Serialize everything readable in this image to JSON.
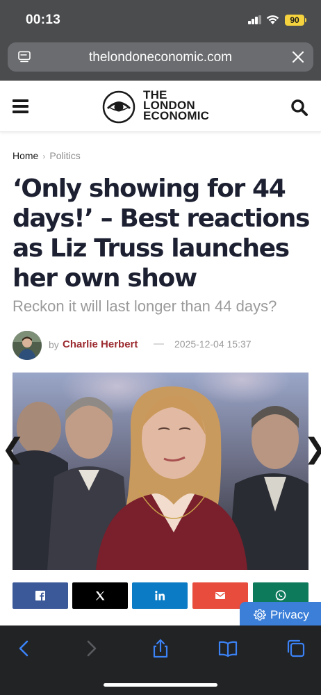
{
  "status_bar": {
    "time": "00:13",
    "battery_level": "90"
  },
  "browser": {
    "url": "thelondoneconomic.com"
  },
  "site": {
    "logo_lines": [
      "THE",
      "LONDON",
      "ECONOMIC"
    ]
  },
  "breadcrumb": {
    "home": "Home",
    "separator": "›",
    "category": "Politics"
  },
  "article": {
    "headline": "‘Only showing for 44 days!’ – Best reactions as Liz Truss launches her own show",
    "subheadline": "Reckon it will last longer than 44 days?",
    "byline_prefix": "by",
    "author": "Charlie Herbert",
    "dash": "—",
    "date": "2025-12-04 15:37"
  },
  "gallery": {
    "prev_glyph": "❮",
    "next_glyph": "❯"
  },
  "share": [
    {
      "network": "facebook",
      "icon": "facebook-icon",
      "color": "#3b5998"
    },
    {
      "network": "x",
      "icon": "x-icon",
      "color": "#000000"
    },
    {
      "network": "linkedin",
      "icon": "linkedin-icon",
      "color": "#0a7bc4"
    },
    {
      "network": "email",
      "icon": "email-icon",
      "color": "#e74c3c"
    },
    {
      "network": "whatsapp",
      "icon": "whatsapp-icon",
      "color": "#0e7a5c"
    }
  ],
  "privacy": {
    "label": "Privacy",
    "icon": "gear-icon"
  },
  "toolbar": {
    "items": [
      "back-icon",
      "forward-icon",
      "share-icon",
      "bookmarks-icon",
      "tabs-icon"
    ],
    "accent": "#3b82f6"
  },
  "colors": {
    "chrome": "#4b4c4e",
    "headline": "#1c2031",
    "author": "#9b2a2f",
    "privacy": "#3b7fd9"
  }
}
